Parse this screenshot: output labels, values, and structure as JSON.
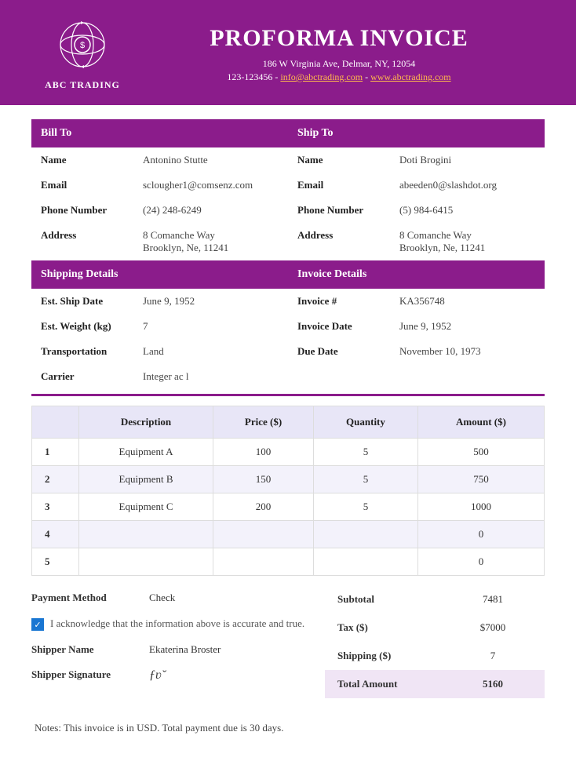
{
  "company": {
    "name": "ABC TRADING"
  },
  "header": {
    "title": "PROFORMA INVOICE",
    "address": "186 W Virginia Ave, Delmar, NY, 12054",
    "phone": "123-123456",
    "email": "info@abctrading.com",
    "website": "www.abctrading.com",
    "sep1": " - ",
    "sep2": " - "
  },
  "sections": {
    "bill_to": "Bill To",
    "ship_to": "Ship To",
    "shipping_details": "Shipping Details",
    "invoice_details": "Invoice Details"
  },
  "labels": {
    "name": "Name",
    "email": "Email",
    "phone": "Phone Number",
    "address": "Address",
    "est_ship_date": "Est. Ship Date",
    "est_weight": "Est. Weight (kg)",
    "transportation": "Transportation",
    "carrier": "Carrier",
    "invoice_num": "Invoice #",
    "invoice_date": "Invoice Date",
    "due_date": "Due Date",
    "payment_method": "Payment Method",
    "shipper_name": "Shipper Name",
    "shipper_signature": "Shipper Signature",
    "subtotal": "Subtotal",
    "tax": "Tax ($)",
    "shipping": "Shipping ($)",
    "total": "Total Amount"
  },
  "bill_to": {
    "name": "Antonino Stutte",
    "email": "sclougher1@comsenz.com",
    "phone": "(24) 248-6249",
    "address_line1": "8 Comanche Way",
    "address_line2": "Brooklyn, Ne, 11241"
  },
  "ship_to": {
    "name": "Doti Brogini",
    "email": "abeeden0@slashdot.org",
    "phone": "(5) 984-6415",
    "address_line1": "8 Comanche Way",
    "address_line2": "Brooklyn, Ne, 11241"
  },
  "shipping": {
    "est_ship_date": "June 9, 1952",
    "est_weight": "7",
    "transportation": "Land",
    "carrier": "Integer ac l"
  },
  "invoice": {
    "number": "KA356748",
    "date": "June 9, 1952",
    "due_date": "November 10, 1973"
  },
  "table": {
    "headers": {
      "description": "Description",
      "price": "Price ($)",
      "quantity": "Quantity",
      "amount": "Amount ($)"
    },
    "rows": [
      {
        "n": "1",
        "desc": "Equipment A",
        "price": "100",
        "qty": "5",
        "amount": "500"
      },
      {
        "n": "2",
        "desc": "Equipment B",
        "price": "150",
        "qty": "5",
        "amount": "750"
      },
      {
        "n": "3",
        "desc": "Equipment C",
        "price": "200",
        "qty": "5",
        "amount": "1000"
      },
      {
        "n": "4",
        "desc": "",
        "price": "",
        "qty": "",
        "amount": "0"
      },
      {
        "n": "5",
        "desc": "",
        "price": "",
        "qty": "",
        "amount": "0"
      }
    ]
  },
  "payment": {
    "method": "Check",
    "acknowledge": "I acknowledge that the information above is accurate and true.",
    "shipper_name": "Ekaterina Broster",
    "signature": "ƒʋ˘"
  },
  "totals": {
    "subtotal": "7481",
    "tax": "$7000",
    "shipping": "7",
    "total": "5160"
  },
  "notes": "Notes: This invoice is in USD. Total payment due is 30 days."
}
